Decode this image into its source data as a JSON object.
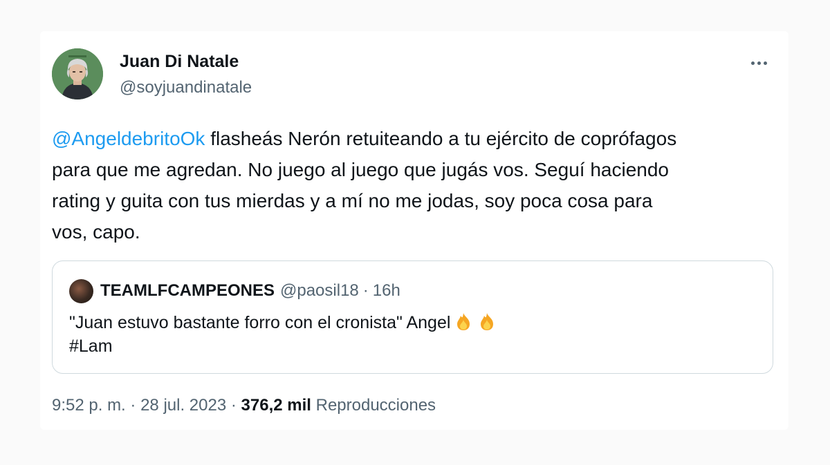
{
  "tweet": {
    "author": {
      "name": "Juan Di Natale",
      "handle": "@soyjuandinatale"
    },
    "text": {
      "mention": "@AngeldebritoOk",
      "line1_rest": " flasheás Nerón retuiteando a tu ejército de coprófagos",
      "line2": "para que me agredan. No juego al juego que jugás vos. Seguí haciendo",
      "line3": "rating y guita con tus mierdas y a mí no me jodas, soy poca cosa para",
      "line4": "vos, capo."
    },
    "quoted": {
      "name": "TEAMLFCAMPEONES",
      "handle": "@paosil18",
      "separator": "·",
      "time": "16h",
      "text_line1": "\"Juan estuvo bastante forro con el cronista\" Angel",
      "text_line2": "#Lam",
      "emoji_icons": [
        "fire-icon",
        "fire-icon"
      ]
    },
    "meta": {
      "time": "9:52 p. m.",
      "sep1": "·",
      "date": "28 jul. 2023",
      "sep2": "·",
      "views_count": "376,2 mil",
      "views_label": "Reproducciones"
    }
  },
  "colors": {
    "link": "#1d9bf0",
    "text": "#0f1419",
    "secondary": "#536471",
    "border": "#cfd9de",
    "background": "#fafafa",
    "card": "#ffffff"
  }
}
